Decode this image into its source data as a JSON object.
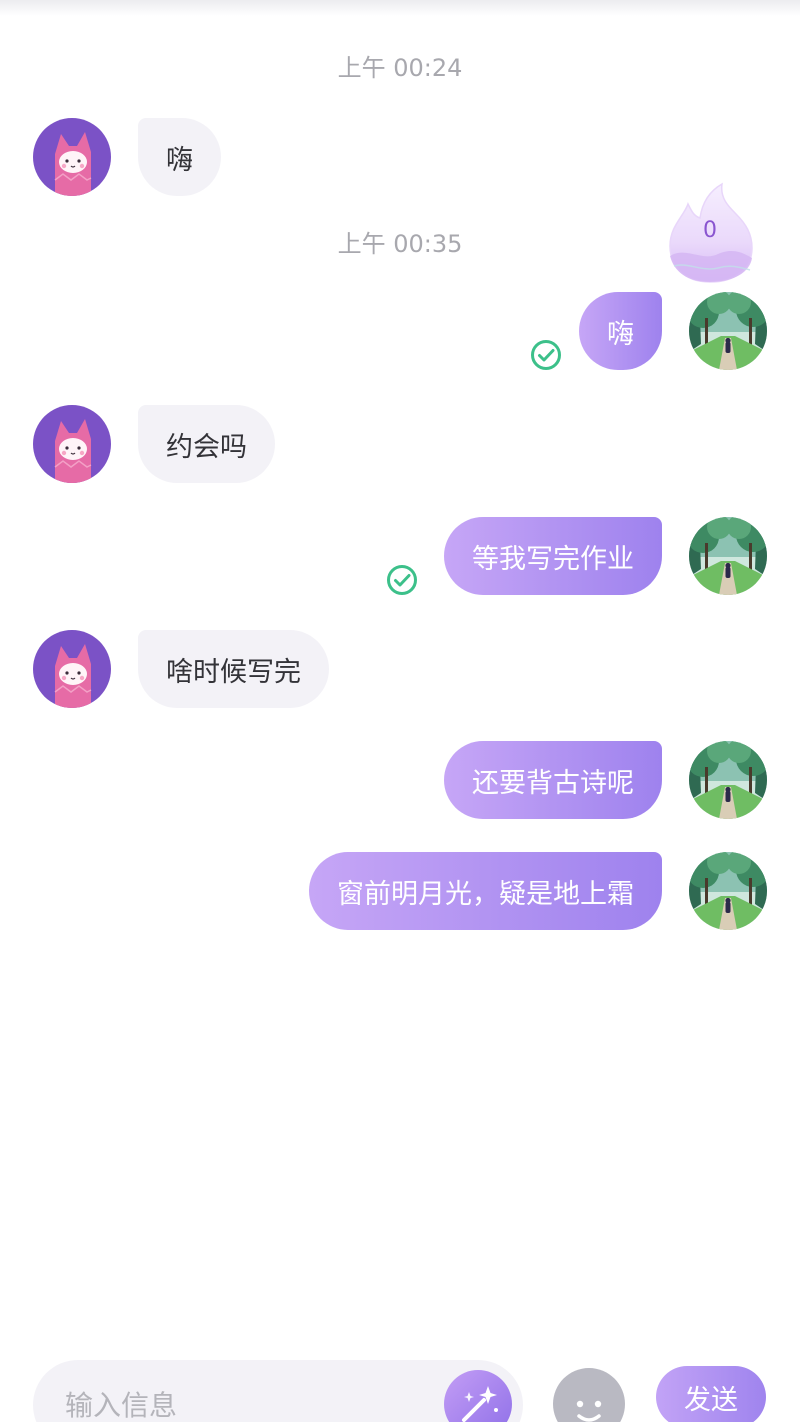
{
  "chat": {
    "timestamps": [
      "上午 00:24",
      "上午 00:35"
    ],
    "messages": [
      {
        "from": "other",
        "text": "嗨"
      },
      {
        "from": "me",
        "text": "嗨",
        "read": true
      },
      {
        "from": "other",
        "text": "约会吗"
      },
      {
        "from": "me",
        "text": "等我写完作业",
        "read": true
      },
      {
        "from": "other",
        "text": "啥时候写完"
      },
      {
        "from": "me",
        "text": "还要背古诗呢"
      },
      {
        "from": "me",
        "text": "窗前明月光，疑是地上霜"
      }
    ],
    "heat_badge": {
      "count": "0",
      "icon": "flame-icon"
    }
  },
  "composer": {
    "placeholder": "输入信息",
    "send_label": "发送",
    "magic_icon": "magic-wand-icon",
    "emoji_icon": "emoji-icon"
  },
  "colors": {
    "outgoing_bubble_start": "#c6a6f6",
    "outgoing_bubble_end": "#9e82ee",
    "incoming_bubble": "#f3f2f7",
    "read_check": "#3cc08a",
    "other_avatar_bg": "#7b52c6",
    "other_avatar_char": "#e66ba6"
  }
}
